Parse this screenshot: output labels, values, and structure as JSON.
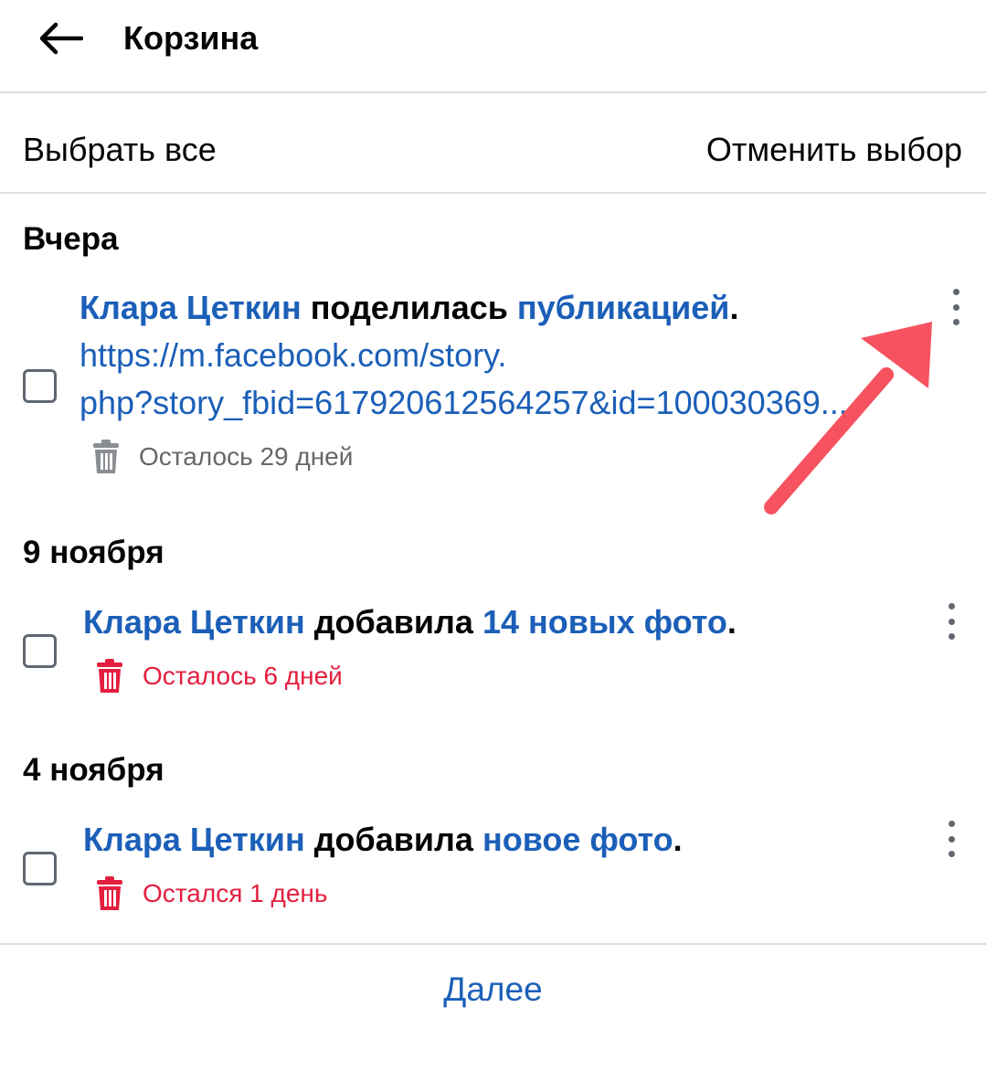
{
  "header": {
    "title": "Корзина",
    "back_icon": "arrow-left-icon"
  },
  "select_bar": {
    "select_all": "Выбрать все",
    "cancel_select": "Отменить выбор"
  },
  "sections": [
    {
      "title": "Вчера",
      "entries": [
        {
          "author": "Клара Цеткин",
          "action": " поделилась ",
          "object": "публикацией",
          "tail": ".",
          "url": "https://m.facebook.com/story.",
          "url_line2": "php?story_fbid=617920612564257&id=100030369...",
          "remaining": "Осталось 29 дней"
        }
      ]
    },
    {
      "title": "9 ноября",
      "entries": [
        {
          "author": "Клара Цеткин",
          "action": " добавила ",
          "object": "14 новых фото",
          "tail": ".",
          "remaining": "Осталось 6 дней"
        }
      ]
    },
    {
      "title": "4 ноября",
      "entries": [
        {
          "author": "Клара Цеткин",
          "action": " добавила ",
          "object": "новое фото",
          "tail": ".",
          "remaining": "Остался 1 день"
        }
      ]
    }
  ],
  "footer": {
    "next": "Далее"
  },
  "colors": {
    "link": "#1b5fb8",
    "warning": "#e41e3f",
    "muted": "#65676b",
    "annotation_arrow": "#f6525f"
  }
}
